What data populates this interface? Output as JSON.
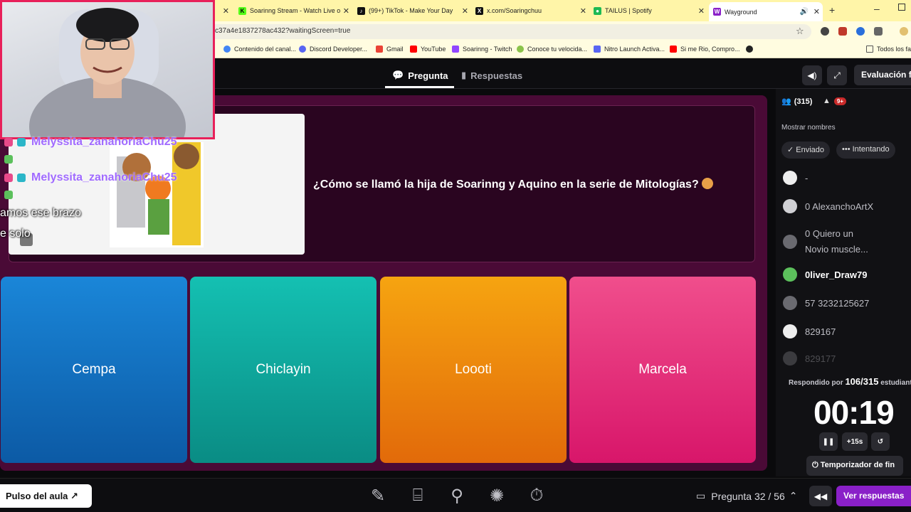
{
  "browser": {
    "tabs": [
      {
        "title": "Soarinng Stream - Watch Live o",
        "fav": "K"
      },
      {
        "title": "(99+) TikTok - Make Your Day",
        "fav": "♪"
      },
      {
        "title": "x.com/Soaringchuu",
        "fav": "X"
      },
      {
        "title": "TAILUS | Spotify",
        "fav": "●"
      },
      {
        "title": "Wayground",
        "fav": "W"
      }
    ],
    "url": "c37a4e1837278ac432?waitingScreen=true",
    "bookmarks": [
      "Contenido del canal...",
      "Discord Developer...",
      "Gmail",
      "YouTube",
      "Soarinng - Twitch",
      "Conoce tu velocida...",
      "Nitro Launch Activa...",
      "Si me Rio, Compro...",
      "Todos los fav"
    ]
  },
  "app": {
    "tabs": [
      {
        "label": "Pregunta",
        "icon": "chat-bubble-icon"
      },
      {
        "label": "Respuestas",
        "icon": "bar-chart-icon"
      }
    ],
    "eval_button": "Evaluación fin"
  },
  "question": {
    "text": "¿Cómo se llamó la hija de Soarinng y Aquino en la serie de Mitologías?",
    "options": [
      "Cempa",
      "Chiclayin",
      "Loooti",
      "Marcela"
    ]
  },
  "panel": {
    "participants": "(315)",
    "alerts": "9+",
    "show_names": "Mostrar nombres",
    "filter_sent": "Enviado",
    "filter_trying": "Intentando",
    "students": [
      {
        "name": "-",
        "highlight": false
      },
      {
        "name": "0 AlexanchoArtX",
        "highlight": false
      },
      {
        "name": "0 Quiero un",
        "name2": "Novio muscle...",
        "highlight": false
      },
      {
        "name": "0liver_Draw79",
        "highlight": true
      },
      {
        "name": "57 3232125627",
        "highlight": false
      },
      {
        "name": "829167",
        "highlight": false
      },
      {
        "name": "829177",
        "highlight": false
      }
    ],
    "answered_prefix": "Respondido por",
    "answered_count": "106/315",
    "answered_suffix": "estudiant",
    "timer": "00:19",
    "add_time": "+15s",
    "end_timer": "Temporizador de fin"
  },
  "bottom": {
    "pulse": "Pulso del aula",
    "question_counter": "Pregunta 32 / 56",
    "view_answers": "Ver respuestas"
  },
  "overlay": {
    "chat": [
      {
        "user": "Melyssita_zanahoriaChu25"
      },
      {
        "user": "Melyssita_zanahoriaChu25"
      }
    ],
    "msg1": "amos ese brazo",
    "msg2": "e solo"
  },
  "colors": {
    "accent": "#8a20c8",
    "stage": "#4a0a36",
    "opt_a": "#1a86d8",
    "opt_b": "#14c0b2",
    "opt_c": "#f6a410",
    "opt_d": "#f04e8c"
  }
}
